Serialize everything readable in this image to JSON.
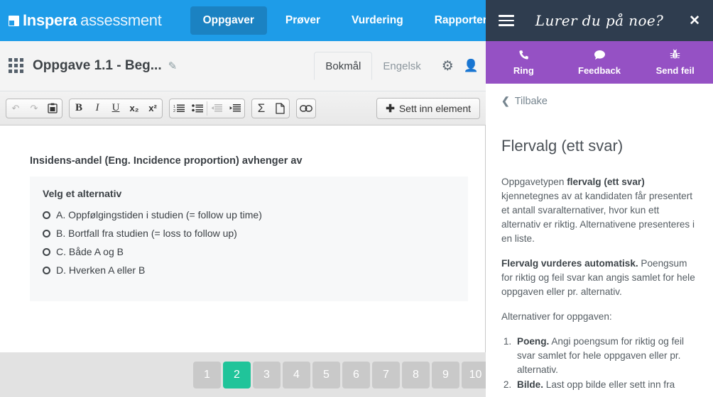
{
  "topnav": {
    "brand_strong": "Inspera",
    "brand_light": "assessment",
    "brand_mark_icon": "inspera-logo-icon",
    "items": [
      {
        "label": "Oppgaver",
        "active": true
      },
      {
        "label": "Prøver",
        "active": false
      },
      {
        "label": "Vurdering",
        "active": false
      },
      {
        "label": "Rapporter",
        "active": false
      }
    ]
  },
  "subheader": {
    "grid_icon": "grid-menu-icon",
    "title": "Oppgave 1.1 - Beg...",
    "edit_icon": "pencil-icon",
    "lang_tabs": [
      {
        "label": "Bokmål",
        "active": true
      },
      {
        "label": "Engelsk",
        "active": false
      }
    ],
    "settings_icon": "gear-icon",
    "user_icon": "user-icon"
  },
  "toolbar": {
    "groups": [
      {
        "buttons": [
          {
            "name": "undo-button",
            "glyph": "↶",
            "disabled": true
          },
          {
            "name": "redo-button",
            "glyph": "↷",
            "disabled": true
          },
          {
            "name": "paste-from-word-button",
            "glyph": "📋",
            "disabled": false
          }
        ]
      },
      {
        "buttons": [
          {
            "name": "bold-button",
            "glyph": "B",
            "disabled": false
          },
          {
            "name": "italic-button",
            "glyph": "I",
            "disabled": false
          },
          {
            "name": "underline-button",
            "glyph": "U",
            "disabled": false
          },
          {
            "name": "subscript-button",
            "glyph": "x₂",
            "disabled": false
          },
          {
            "name": "superscript-button",
            "glyph": "x²",
            "disabled": false
          }
        ]
      },
      {
        "buttons": [
          {
            "name": "numbered-list-button",
            "glyph": "☰",
            "disabled": false
          },
          {
            "name": "bullet-list-button",
            "glyph": "☰",
            "disabled": false
          },
          {
            "name": "outdent-button",
            "glyph": "⇤",
            "disabled": true
          },
          {
            "name": "indent-button",
            "glyph": "⇥",
            "disabled": false
          }
        ]
      },
      {
        "buttons": [
          {
            "name": "formula-button",
            "glyph": "Σ",
            "disabled": false
          },
          {
            "name": "insert-page-button",
            "glyph": "🗋",
            "disabled": false
          }
        ]
      },
      {
        "buttons": [
          {
            "name": "link-button",
            "glyph": "🔗",
            "disabled": false
          }
        ]
      }
    ],
    "insert_element_label": "Sett inn element",
    "insert_element_plus": "✚"
  },
  "editor": {
    "stem": "Insidens-andel (Eng. Incidence proportion) avhenger av",
    "alternatives_title": "Velg et alternativ",
    "alternatives": [
      "A. Oppfølgingstiden i studien (= follow up time)",
      "B. Bortfall fra studien (= loss to follow up)",
      "C. Både A og B",
      "D. Hverken A eller B"
    ]
  },
  "pagination": {
    "pages": [
      "1",
      "2",
      "3",
      "4",
      "5",
      "6",
      "7",
      "8",
      "9",
      "10"
    ],
    "active": "2",
    "active_color": "#20c49a"
  },
  "help_panel": {
    "header": {
      "menu_icon": "hamburger-icon",
      "title": "Lurer du på noe?",
      "close_icon": "close-icon"
    },
    "actions": [
      {
        "icon": "phone-icon",
        "glyph": "✆",
        "label": "Ring"
      },
      {
        "icon": "chat-bubble-icon",
        "glyph": "●",
        "label": "Feedback"
      },
      {
        "icon": "bug-icon",
        "glyph": "✻",
        "label": "Send feil"
      }
    ],
    "back_label": "Tilbake",
    "back_icon": "chevron-left-icon",
    "heading": "Flervalg (ett svar)",
    "paragraphs": [
      {
        "parts": [
          {
            "text": "Oppgavetypen ",
            "bold": false
          },
          {
            "text": "flervalg (ett svar)",
            "bold": true
          },
          {
            "text": " kjennetegnes av at kandidaten får presentert et antall svaralternativer, hvor kun ett alternativ er riktig. Alternativene presenteres i en liste.",
            "bold": false
          }
        ]
      },
      {
        "parts": [
          {
            "text": "Flervalg vurderes automatisk.",
            "bold": true
          },
          {
            "text": " Poengsum for riktig og feil svar kan angis samlet for hele oppgaven eller pr. alternativ.",
            "bold": false
          }
        ]
      },
      {
        "parts": [
          {
            "text": "Alternativer for oppgaven:",
            "bold": false
          }
        ]
      }
    ],
    "list_items": [
      {
        "parts": [
          {
            "text": "Poeng.",
            "bold": true
          },
          {
            "text": " Angi poengsum for riktig og feil svar samlet for hele oppgaven eller pr. alternativ.",
            "bold": false
          }
        ]
      },
      {
        "parts": [
          {
            "text": "Bilde.",
            "bold": true
          },
          {
            "text": " Last opp bilde eller sett inn fra",
            "bold": false
          }
        ]
      }
    ]
  },
  "colors": {
    "brand_blue": "#1e9ce8",
    "nav_active_blue": "#1b82c2",
    "help_header": "#2f3d4f",
    "help_actions_purple": "#9551c4",
    "pager_active_green": "#20c49a"
  }
}
